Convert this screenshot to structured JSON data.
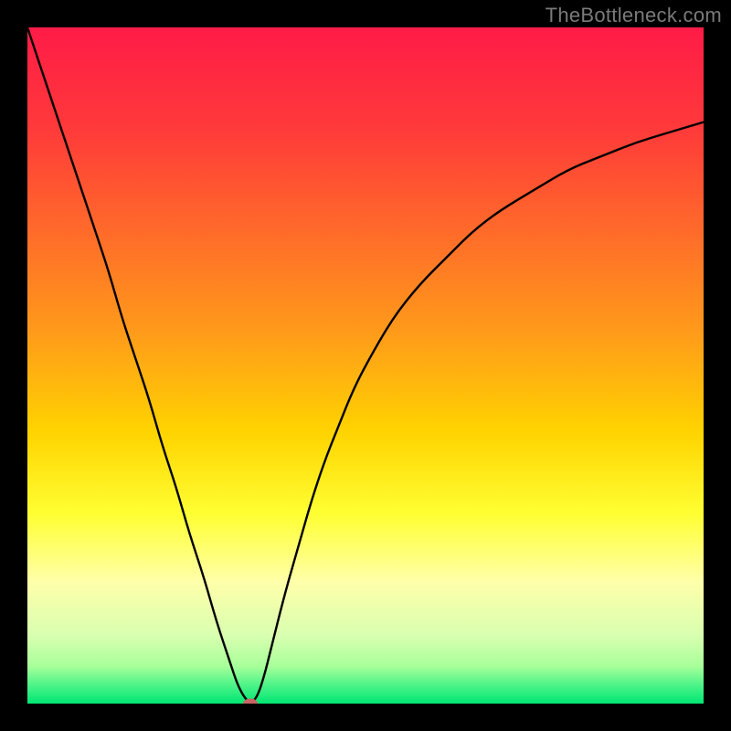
{
  "watermark": "TheBottleneck.com",
  "chart_data": {
    "type": "line",
    "title": "",
    "xlabel": "",
    "ylabel": "",
    "xlim": [
      0,
      100
    ],
    "ylim": [
      0,
      100
    ],
    "grid": false,
    "legend": false,
    "gradient_stops": [
      {
        "offset": 0.0,
        "color": "#ff1b47"
      },
      {
        "offset": 0.15,
        "color": "#ff3a3a"
      },
      {
        "offset": 0.3,
        "color": "#ff6a2a"
      },
      {
        "offset": 0.45,
        "color": "#ff9a1a"
      },
      {
        "offset": 0.6,
        "color": "#ffd400"
      },
      {
        "offset": 0.72,
        "color": "#ffff33"
      },
      {
        "offset": 0.82,
        "color": "#ffffaa"
      },
      {
        "offset": 0.9,
        "color": "#d8ffb0"
      },
      {
        "offset": 0.945,
        "color": "#a8ff9a"
      },
      {
        "offset": 0.97,
        "color": "#55f58a"
      },
      {
        "offset": 1.0,
        "color": "#00e673"
      }
    ],
    "series": [
      {
        "name": "bottleneck-curve",
        "color": "#000000",
        "stroke_width": 2.4,
        "x": [
          0,
          2,
          4,
          6,
          8,
          10,
          12,
          14,
          16,
          18,
          20,
          22,
          24,
          26,
          28,
          30,
          31,
          32,
          33,
          34,
          35,
          36,
          38,
          40,
          42,
          44,
          46,
          48,
          50,
          54,
          58,
          62,
          66,
          70,
          75,
          80,
          85,
          90,
          95,
          100
        ],
        "y": [
          100,
          94,
          88,
          82,
          76,
          70,
          64,
          57,
          51,
          45,
          38,
          32,
          25,
          19,
          12,
          6,
          3,
          1,
          0,
          1,
          4,
          8,
          16,
          23,
          30,
          36,
          41,
          46,
          50,
          57,
          62,
          66,
          70,
          73,
          76,
          79,
          81,
          83,
          84.5,
          86
        ]
      }
    ],
    "marker": {
      "x": 33,
      "y": 0,
      "color": "#c86464"
    }
  }
}
